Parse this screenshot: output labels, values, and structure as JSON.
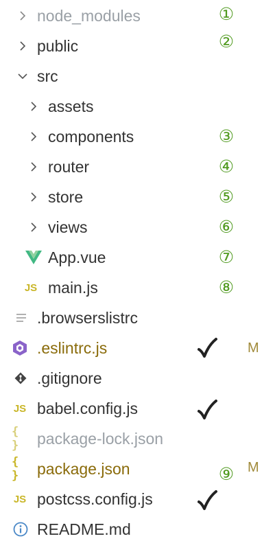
{
  "tree": {
    "items": [
      {
        "label": "node_modules",
        "badge": "①"
      },
      {
        "label": "public",
        "badge": "②"
      },
      {
        "label": "src"
      },
      {
        "label": "assets"
      },
      {
        "label": "components",
        "badge": "③"
      },
      {
        "label": "router",
        "badge": "④"
      },
      {
        "label": "store",
        "badge": "⑤"
      },
      {
        "label": "views",
        "badge": "⑥"
      },
      {
        "label": "App.vue",
        "badge": "⑦"
      },
      {
        "label": "main.js",
        "badge": "⑧"
      },
      {
        "label": ".browserslistrc"
      },
      {
        "label": ".eslintrc.js",
        "flag": "M"
      },
      {
        "label": ".gitignore"
      },
      {
        "label": "babel.config.js"
      },
      {
        "label": "package-lock.json"
      },
      {
        "label": "package.json",
        "badge": "⑨",
        "flag": "M"
      },
      {
        "label": "postcss.config.js"
      },
      {
        "label": "README.md"
      }
    ]
  },
  "icons": {
    "js_text": "JS",
    "json_text": "{ }"
  },
  "colors": {
    "badge_green": "#4f9a1e",
    "modified_text": "#8a6b0a",
    "ignored_text": "#9aa0a6",
    "js_yellow": "#c9b628",
    "vue_green": "#41b883",
    "eslint_purple": "#8a63c9",
    "info_blue": "#4a88c7"
  }
}
